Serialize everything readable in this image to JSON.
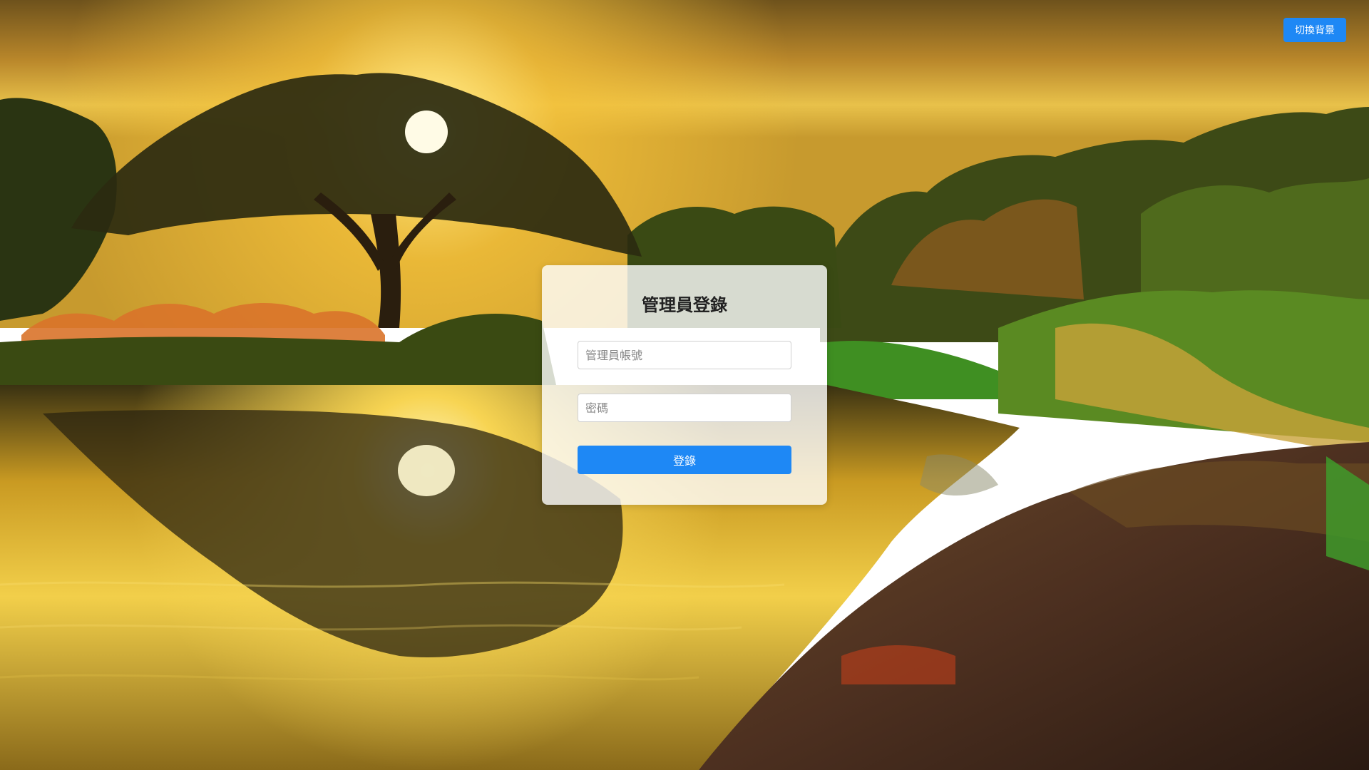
{
  "background": {
    "image": "sunset-lake-landscape",
    "colors": {
      "sky_top": "#7a5a1e",
      "sun": "#fff3a8",
      "glow": "#f0b32a",
      "foliage": "#2e3d12",
      "grass": "#5ea52a",
      "water": "#d9a524",
      "bank": "#4a2e1e"
    }
  },
  "toolbar": {
    "switch_background_label": "切換背景"
  },
  "login": {
    "title": "管理員登錄",
    "account_placeholder": "管理員帳號",
    "account_value": "",
    "password_placeholder": "密碼",
    "password_value": "",
    "submit_label": "登錄"
  },
  "colors": {
    "accent": "#1e88f5",
    "card": "rgba(255,255,255,0.8)"
  }
}
